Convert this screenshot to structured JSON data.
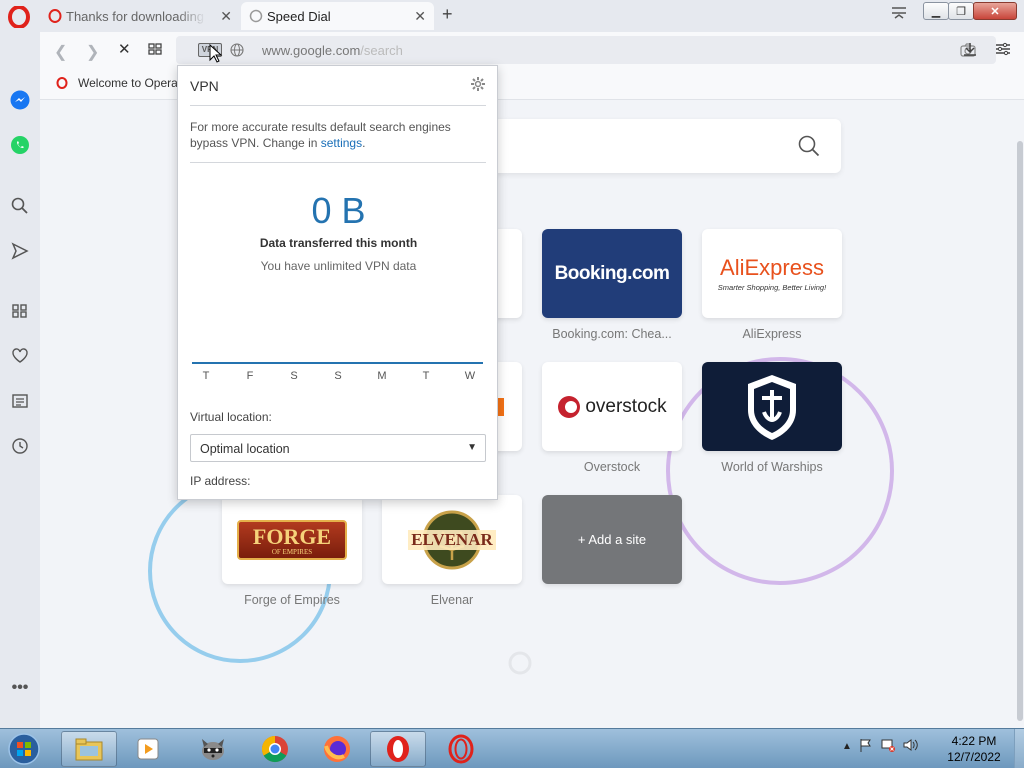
{
  "tabs": [
    {
      "title": "Thanks for downloading Opera",
      "active": false
    },
    {
      "title": "Speed Dial",
      "active": true
    }
  ],
  "toolbar": {
    "vpn_badge": "VPN",
    "url_host": "www.google.com",
    "url_path": "/search"
  },
  "bookmarks": [
    {
      "label": "Welcome to Opera"
    }
  ],
  "speed_dial": {
    "tiles": [
      {
        "label": "Booking.com: Chea...",
        "logo_text": "Booking.com"
      },
      {
        "label": "AliExpress",
        "logo_text": "AliExpress",
        "logo_sub": "Smarter Shopping, Better Living!"
      },
      {
        "label": "Overstock",
        "logo_text": "overstock"
      },
      {
        "label": "World of Warships"
      },
      {
        "label": "Forge of Empires",
        "logo_text": "FORGE",
        "logo_sub": "OF EMPIRES"
      },
      {
        "label": "Elvenar",
        "logo_text": "ELVENAR"
      },
      {
        "label": "+ Add a site"
      }
    ]
  },
  "vpn": {
    "title": "VPN",
    "note": "For more accurate results default search engines bypass VPN. Change in ",
    "note_link": "settings",
    "note_end": ".",
    "amount": "0 B",
    "data_label": "Data transferred this month",
    "unlimited": "You have unlimited VPN data",
    "days": [
      "T",
      "F",
      "S",
      "S",
      "M",
      "T",
      "W"
    ],
    "location_label": "Virtual location:",
    "location_value": "Optimal location",
    "ip_label": "IP address:"
  },
  "taskbar": {
    "time": "4:22 PM",
    "date": "12/7/2022"
  },
  "colors": {
    "opera_red": "#e0221b",
    "vpn_blue": "#2473b0",
    "booking_blue": "#213d79",
    "warships_navy": "#0f1d38"
  }
}
